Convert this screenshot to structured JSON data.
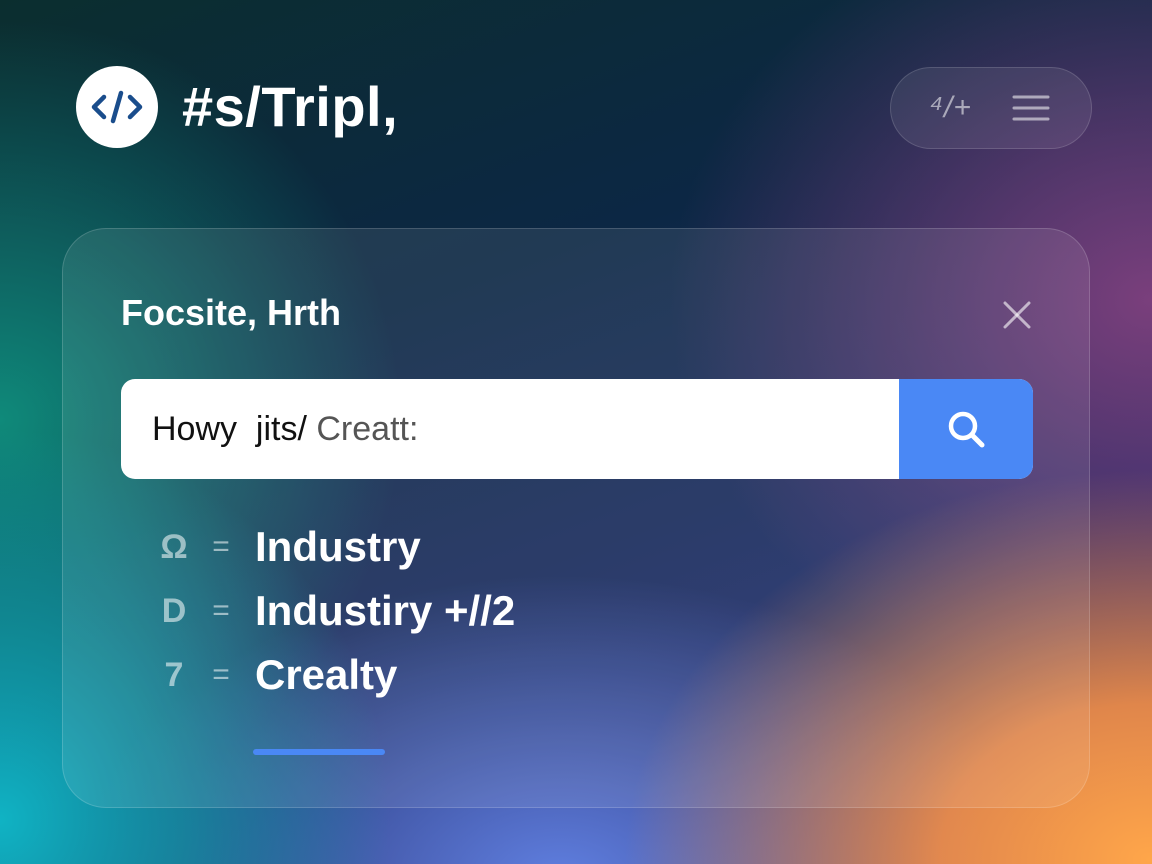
{
  "header": {
    "logo_icon": "code-brackets-icon",
    "title": "#s/Tripl,",
    "pill_buttons": [
      {
        "icon": "code-toggle-icon",
        "label": "⁴/+"
      },
      {
        "icon": "hamburger-menu-icon"
      }
    ]
  },
  "card": {
    "title": "Focsite, Hrth",
    "close_icon": "close-icon",
    "search": {
      "value": "Howy  jits/",
      "placeholder": "Creatt:",
      "button_icon": "search-icon",
      "button_color": "#4a88f5"
    },
    "results": [
      {
        "icon": "Ω",
        "sep": "=",
        "label": "Industry"
      },
      {
        "icon": "D",
        "sep": "=",
        "label": "Industiry +//2"
      },
      {
        "icon": "7",
        "sep": "=",
        "label": "Crealty"
      }
    ]
  },
  "colors": {
    "accent": "#4a88f5",
    "text": "#ffffff",
    "logo_icon": "#1a4d8c"
  }
}
